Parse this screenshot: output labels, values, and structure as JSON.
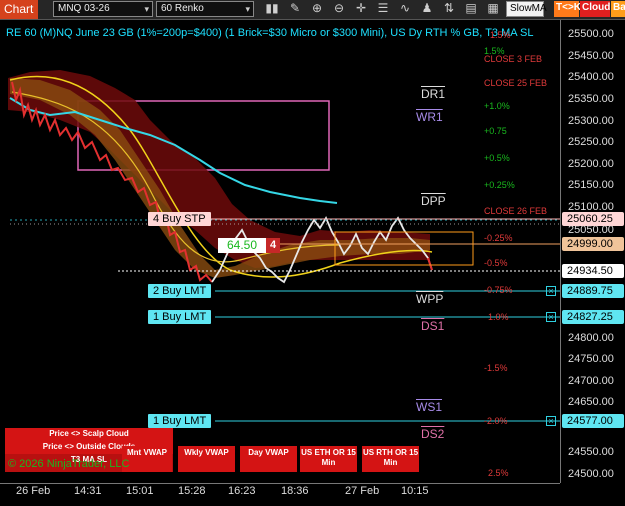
{
  "toolbar": {
    "chart_tab": "Chart",
    "instrument": "MNQ 03-26",
    "period": "60 Renko",
    "indicator_select": "SlowMA",
    "tc_button": "T<>K",
    "cloud_button": "Cloud",
    "bars_button": "Bars",
    "icons": [
      "bars-type-icon",
      "pencil-icon",
      "zoom-in-icon",
      "zoom-out-icon",
      "crosshair-icon",
      "properties-icon",
      "indicators-icon",
      "strategies-icon",
      "chart-trader-icon",
      "templates-icon",
      "data-box-icon"
    ]
  },
  "chart_title": "RE 60 (M)NQ June 23 GB (1%=200p=$400) (1 Brick=$30 Micro or $300 Mini), US Dy RTH % GB, T3 MA SL",
  "price_axis": {
    "ticks": [
      "25500.00",
      "25450.00",
      "25400.00",
      "25350.00",
      "25300.00",
      "25250.00",
      "25200.00",
      "25150.00",
      "25100.00",
      "25050.00",
      "24800.00",
      "24750.00",
      "24700.00",
      "24650.00",
      "24600.00",
      "24550.00",
      "24500.00"
    ],
    "badges": [
      {
        "label": "25060.25",
        "color": "#ffd6d6"
      },
      {
        "label": "24999.00",
        "color": "#f0c49a"
      },
      {
        "label": "24934.50",
        "color": "#ffffff"
      },
      {
        "label": "24889.75",
        "color": "#5fe6f2"
      },
      {
        "label": "24827.25",
        "color": "#5fe6f2"
      },
      {
        "label": "24577.00",
        "color": "#5fe6f2"
      }
    ]
  },
  "time_axis": {
    "ticks": [
      "26 Feb",
      "14:31",
      "15:01",
      "15:28",
      "16:23",
      "18:36",
      "27 Feb",
      "10:15"
    ]
  },
  "levels": {
    "dr1": "DR1",
    "wr1": "WR1",
    "dpp": "DPP",
    "wpp": "WPP",
    "ds1": "DS1",
    "ws1": "WS1",
    "ds2": "DS2"
  },
  "percent_labels": {
    "pct_top": "1.5%",
    "close_3feb": "CLOSE 3 FEB",
    "close_25feb": "CLOSE 25 FEB",
    "p100": "+1.0%",
    "p075": "+0.75",
    "p050": "+0.5%",
    "p025": "+0.25%",
    "close_26feb": "CLOSE 26 FEB",
    "m025": "-0.25%",
    "m05": "-0.5%",
    "m075": "-0.75%",
    "m10": "1.0%",
    "m15": "-1.5%",
    "m20": "-2.0%",
    "m25": "2.5%"
  },
  "orders": {
    "buy_stp": "4 Buy STP",
    "buy_lmt_2": "2 Buy LMT",
    "buy_lmt_1a": "1 Buy LMT",
    "buy_lmt_1b": "1 Buy LMT"
  },
  "position": {
    "pnl": "64.50",
    "qty": "4"
  },
  "buttons": {
    "scalp_cloud": "Price <> Scalp Cloud",
    "outside_clouds": "Price <> Outside Clouds",
    "t3_ma_sl": "T3 MA SL",
    "mnt_vwap": "Mnt VWAP",
    "wkly_vwap": "Wkly VWAP",
    "day_vwap": "Day VWAP",
    "us_eth": "US ETH OR 15 Min",
    "us_rth": "US RTH OR 15 Min"
  },
  "copyright": "© 2026 NinjaTrader, LLC",
  "colors": {
    "accent": "#1ee0ff",
    "chart_tab": "#d5421c",
    "order_line": "#2fd0e0",
    "pnl_green": "#19b81e"
  }
}
